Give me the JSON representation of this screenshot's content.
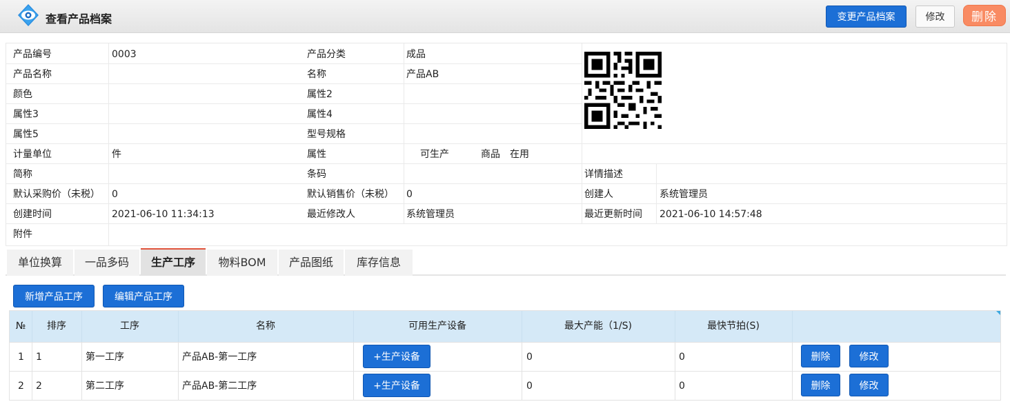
{
  "header": {
    "title": "查看产品档案",
    "change_button": "变更产品档案",
    "modify_button": "修改",
    "delete_button": "删除"
  },
  "info": {
    "product_code_label": "产品编号",
    "product_code": "0003",
    "category_label": "产品分类",
    "category": "成品",
    "product_name_label": "产品名称",
    "product_name": "",
    "name_label": "名称",
    "name": "产品AB",
    "color_label": "颜色",
    "color": "",
    "attr2_label": "属性2",
    "attr2": "",
    "attr3_label": "属性3",
    "attr3": "",
    "attr4_label": "属性4",
    "attr4": "",
    "attr5_label": "属性5",
    "attr5": "",
    "model_label": "型号规格",
    "model": "",
    "unit_label": "计量单位",
    "unit": "件",
    "attribute_label": "属性",
    "attr_producible": "可生产",
    "attr_goods": "商品",
    "attr_status": "在用",
    "short_name_label": "简称",
    "short_name": "",
    "barcode_label": "条码",
    "barcode": "",
    "detail_label": "详情描述",
    "detail": "",
    "purchase_price_label": "默认采购价（未税）",
    "purchase_price": "0",
    "sale_price_label": "默认销售价（未税）",
    "sale_price": "0",
    "creator_label": "创建人",
    "creator": "系统管理员",
    "created_time_label": "创建时间",
    "created_time": "2021-06-10 11:34:13",
    "modifier_label": "最近修改人",
    "modifier": "系统管理员",
    "updated_time_label": "最近更新时间",
    "updated_time": "2021-06-10 14:57:48",
    "attachment_label": "附件"
  },
  "tabs": [
    "单位换算",
    "一品多码",
    "生产工序",
    "物料BOM",
    "产品图纸",
    "库存信息"
  ],
  "active_tab": "生产工序",
  "actions": {
    "add": "新增产品工序",
    "edit": "编辑产品工序"
  },
  "table": {
    "headers": [
      "№",
      "排序",
      "工序",
      "名称",
      "可用生产设备",
      "最大产能（1/S)",
      "最快节拍(S)",
      ""
    ],
    "equip_button": "+生产设备",
    "delete_button": "删除",
    "modify_button": "修改",
    "rows": [
      {
        "no": "1",
        "order": "1",
        "process": "第一工序",
        "name": "产品AB-第一工序",
        "capacity": "0",
        "beat": "0"
      },
      {
        "no": "2",
        "order": "2",
        "process": "第二工序",
        "name": "产品AB-第二工序",
        "capacity": "0",
        "beat": "0"
      }
    ]
  },
  "colors": {
    "primary": "#1c6fd6",
    "danger": "#f98b63",
    "table_header": "#d5e9f7",
    "active_tab_border": "#e0523a"
  }
}
